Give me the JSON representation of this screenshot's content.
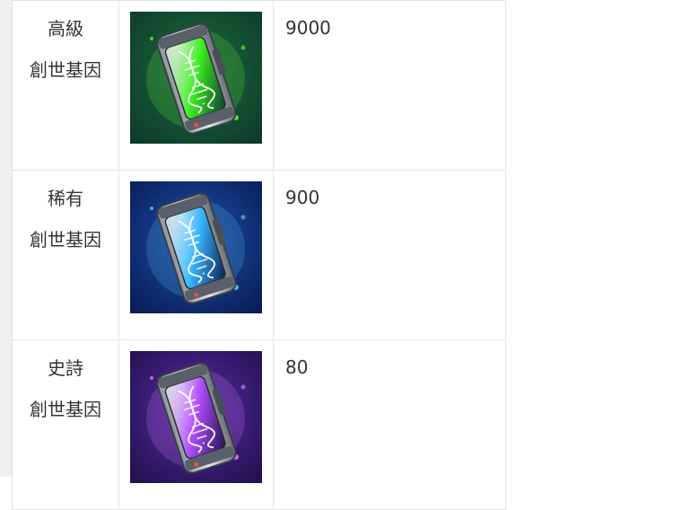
{
  "rows": [
    {
      "tier": "高級",
      "name": "創世基因",
      "value": "9000",
      "theme": {
        "bg1": "#0e3b2c",
        "bg2": "#1c6b3a",
        "glow": "#6dff3c",
        "fluid": "#3cf020",
        "icon": "dna-capsule-green-icon"
      }
    },
    {
      "tier": "稀有",
      "name": "創世基因",
      "value": "900",
      "theme": {
        "bg1": "#0a1e55",
        "bg2": "#1d4fb0",
        "glow": "#5fd8ff",
        "fluid": "#38b8ff",
        "icon": "dna-capsule-blue-icon"
      }
    },
    {
      "tier": "史詩",
      "name": "創世基因",
      "value": "80",
      "theme": {
        "bg1": "#22124e",
        "bg2": "#5a2aa8",
        "glow": "#e48cff",
        "fluid": "#b24cff",
        "icon": "dna-capsule-purple-icon"
      }
    }
  ]
}
